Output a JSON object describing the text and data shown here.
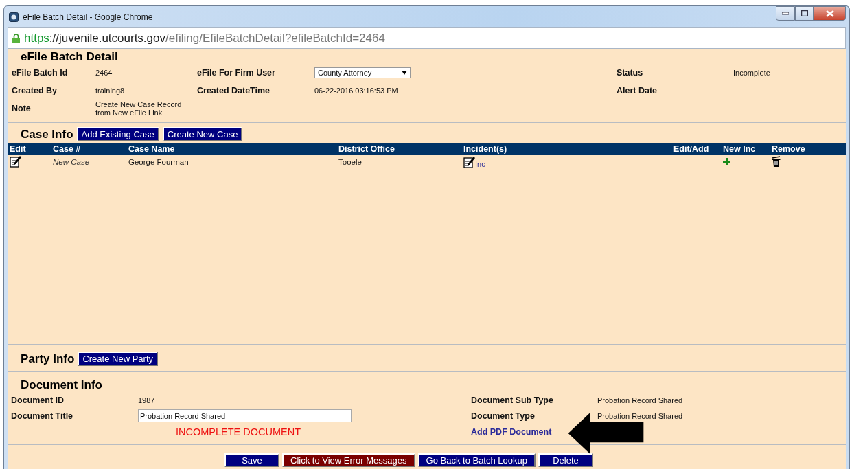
{
  "window": {
    "title": "eFile Batch Detail - Google Chrome",
    "url": [
      {
        "kind": "scheme",
        "text": "https"
      },
      {
        "kind": "host",
        "text": "://juvenile.utcourts.gov"
      },
      {
        "kind": "path",
        "text": "/efiling/EfileBatchDetail?efileBatchId=2464"
      }
    ]
  },
  "batch": {
    "title": "eFile Batch Detail",
    "fields": [
      {
        "label": "eFile Batch Id",
        "kind": "text",
        "value": "2464"
      },
      {
        "label": "eFile For Firm User",
        "kind": "select",
        "value": "County Attorney"
      },
      {
        "label": "Status",
        "kind": "text",
        "value": "Incomplete"
      },
      {
        "label": "Created By",
        "kind": "text",
        "value": "training8"
      },
      {
        "label": "Created DateTime",
        "kind": "text",
        "value": "06-22-2016 03:16:53 PM"
      },
      {
        "label": "Alert Date",
        "kind": "empty"
      },
      {
        "label": "Note",
        "kind": "text",
        "value": "Create New Case Record from New eFile Link"
      }
    ]
  },
  "case_info": {
    "title": "Case Info",
    "buttons": [
      "Add Existing Case",
      "Create New Case"
    ],
    "table": {
      "columns": [
        "Edit",
        "Case #",
        "Case Name",
        "District Office",
        "Incident(s)",
        "Edit/Add",
        "New Inc",
        "Remove"
      ],
      "rows": [
        {
          "case_number": "New Case",
          "case_name": "George Fourman",
          "district_office": "Tooele",
          "incident_link": "Inc"
        }
      ]
    }
  },
  "party_info": {
    "title": "Party Info",
    "buttons": [
      "Create New Party"
    ]
  },
  "document_info": {
    "title": "Document Info",
    "id_label": "Document ID",
    "id_value": "1987",
    "title_label": "Document Title",
    "title_value": "Probation Record Shared",
    "status_message": "INCOMPLETE DOCUMENT",
    "sub_type_label": "Document Sub Type",
    "sub_type_value": "Probation Record Shared",
    "type_label": "Document Type",
    "type_value": "Probation Record Shared",
    "add_link": "Add PDF Document"
  },
  "footer_buttons": [
    {
      "label": "Save",
      "kind": "primary"
    },
    {
      "label": "Click to View Error Messages",
      "kind": "danger"
    },
    {
      "label": "Go Back to Batch Lookup",
      "kind": "primary"
    },
    {
      "label": "Delete",
      "kind": "primary"
    }
  ]
}
